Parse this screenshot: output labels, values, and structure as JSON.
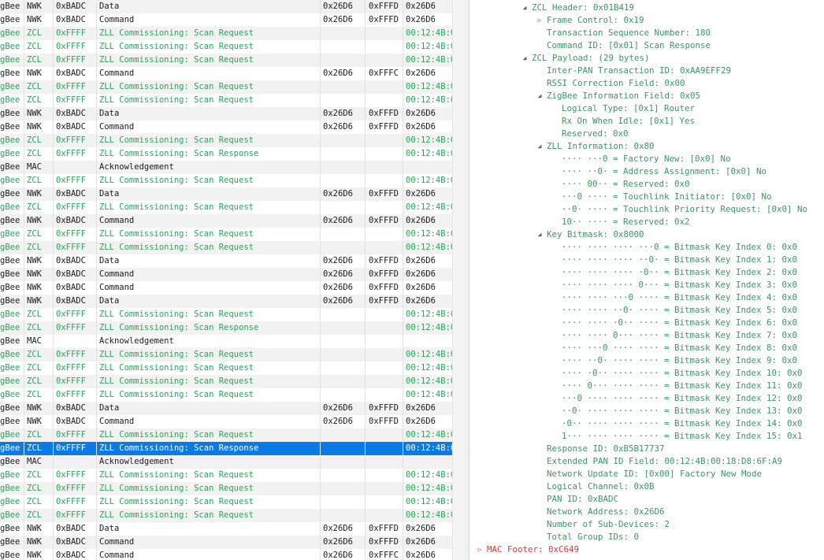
{
  "packet_list": {
    "rows": [
      {
        "proto": "gBee",
        "layer": "NWK",
        "dst": "0xBADC",
        "info": "Data",
        "a": "0x26D6",
        "b": "0xFFFD",
        "c": "0x26D6",
        "kind": "other"
      },
      {
        "proto": "gBee",
        "layer": "NWK",
        "dst": "0xBADC",
        "info": "Command",
        "a": "0x26D6",
        "b": "0xFFFD",
        "c": "0x26D6",
        "kind": "other"
      },
      {
        "proto": "gBee",
        "layer": "ZCL",
        "dst": "0xFFFF",
        "info": "ZLL Commissioning: Scan Request",
        "a": "",
        "b": "",
        "c": "00:12:4B:0",
        "kind": "zll"
      },
      {
        "proto": "gBee",
        "layer": "ZCL",
        "dst": "0xFFFF",
        "info": "ZLL Commissioning: Scan Request",
        "a": "",
        "b": "",
        "c": "00:12:4B:0",
        "kind": "zll"
      },
      {
        "proto": "gBee",
        "layer": "ZCL",
        "dst": "0xFFFF",
        "info": "ZLL Commissioning: Scan Request",
        "a": "",
        "b": "",
        "c": "00:12:4B:0",
        "kind": "zll"
      },
      {
        "proto": "gBee",
        "layer": "NWK",
        "dst": "0xBADC",
        "info": "Command",
        "a": "0x26D6",
        "b": "0xFFFC",
        "c": "0x26D6",
        "kind": "other"
      },
      {
        "proto": "gBee",
        "layer": "ZCL",
        "dst": "0xFFFF",
        "info": "ZLL Commissioning: Scan Request",
        "a": "",
        "b": "",
        "c": "00:12:4B:0",
        "kind": "zll"
      },
      {
        "proto": "gBee",
        "layer": "ZCL",
        "dst": "0xFFFF",
        "info": "ZLL Commissioning: Scan Request",
        "a": "",
        "b": "",
        "c": "00:12:4B:0",
        "kind": "zll"
      },
      {
        "proto": "gBee",
        "layer": "NWK",
        "dst": "0xBADC",
        "info": "Data",
        "a": "0x26D6",
        "b": "0xFFFD",
        "c": "0x26D6",
        "kind": "other"
      },
      {
        "proto": "gBee",
        "layer": "NWK",
        "dst": "0xBADC",
        "info": "Command",
        "a": "0x26D6",
        "b": "0xFFFD",
        "c": "0x26D6",
        "kind": "other"
      },
      {
        "proto": "gBee",
        "layer": "ZCL",
        "dst": "0xFFFF",
        "info": "ZLL Commissioning: Scan Request",
        "a": "",
        "b": "",
        "c": "00:12:4B:0",
        "kind": "zll"
      },
      {
        "proto": "gBee",
        "layer": "ZCL",
        "dst": "0xFFFF",
        "info": "ZLL Commissioning: Scan Response",
        "a": "",
        "b": "",
        "c": "00:12:4B:0",
        "kind": "zll"
      },
      {
        "proto": "gBee",
        "layer": "MAC",
        "dst": "",
        "info": "Acknowledgement",
        "a": "",
        "b": "",
        "c": "",
        "kind": "other"
      },
      {
        "proto": "gBee",
        "layer": "ZCL",
        "dst": "0xFFFF",
        "info": "ZLL Commissioning: Scan Request",
        "a": "",
        "b": "",
        "c": "00:12:4B:0",
        "kind": "zll"
      },
      {
        "proto": "gBee",
        "layer": "NWK",
        "dst": "0xBADC",
        "info": "Data",
        "a": "0x26D6",
        "b": "0xFFFD",
        "c": "0x26D6",
        "kind": "other"
      },
      {
        "proto": "gBee",
        "layer": "ZCL",
        "dst": "0xFFFF",
        "info": "ZLL Commissioning: Scan Request",
        "a": "",
        "b": "",
        "c": "00:12:4B:0",
        "kind": "zll"
      },
      {
        "proto": "gBee",
        "layer": "NWK",
        "dst": "0xBADC",
        "info": "Command",
        "a": "0x26D6",
        "b": "0xFFFD",
        "c": "0x26D6",
        "kind": "other"
      },
      {
        "proto": "gBee",
        "layer": "ZCL",
        "dst": "0xFFFF",
        "info": "ZLL Commissioning: Scan Request",
        "a": "",
        "b": "",
        "c": "00:12:4B:0",
        "kind": "zll"
      },
      {
        "proto": "gBee",
        "layer": "ZCL",
        "dst": "0xFFFF",
        "info": "ZLL Commissioning: Scan Request",
        "a": "",
        "b": "",
        "c": "00:12:4B:0",
        "kind": "zll"
      },
      {
        "proto": "gBee",
        "layer": "NWK",
        "dst": "0xBADC",
        "info": "Data",
        "a": "0x26D6",
        "b": "0xFFFD",
        "c": "0x26D6",
        "kind": "other"
      },
      {
        "proto": "gBee",
        "layer": "NWK",
        "dst": "0xBADC",
        "info": "Command",
        "a": "0x26D6",
        "b": "0xFFFD",
        "c": "0x26D6",
        "kind": "other"
      },
      {
        "proto": "gBee",
        "layer": "NWK",
        "dst": "0xBADC",
        "info": "Command",
        "a": "0x26D6",
        "b": "0xFFFD",
        "c": "0x26D6",
        "kind": "other"
      },
      {
        "proto": "gBee",
        "layer": "NWK",
        "dst": "0xBADC",
        "info": "Data",
        "a": "0x26D6",
        "b": "0xFFFD",
        "c": "0x26D6",
        "kind": "other"
      },
      {
        "proto": "gBee",
        "layer": "ZCL",
        "dst": "0xFFFF",
        "info": "ZLL Commissioning: Scan Request",
        "a": "",
        "b": "",
        "c": "00:12:4B:0",
        "kind": "zll"
      },
      {
        "proto": "gBee",
        "layer": "ZCL",
        "dst": "0xFFFF",
        "info": "ZLL Commissioning: Scan Response",
        "a": "",
        "b": "",
        "c": "00:12:4B:0",
        "kind": "zll"
      },
      {
        "proto": "gBee",
        "layer": "MAC",
        "dst": "",
        "info": "Acknowledgement",
        "a": "",
        "b": "",
        "c": "",
        "kind": "other"
      },
      {
        "proto": "gBee",
        "layer": "ZCL",
        "dst": "0xFFFF",
        "info": "ZLL Commissioning: Scan Request",
        "a": "",
        "b": "",
        "c": "00:12:4B:0",
        "kind": "zll"
      },
      {
        "proto": "gBee",
        "layer": "ZCL",
        "dst": "0xFFFF",
        "info": "ZLL Commissioning: Scan Request",
        "a": "",
        "b": "",
        "c": "00:12:4B:0",
        "kind": "zll"
      },
      {
        "proto": "gBee",
        "layer": "ZCL",
        "dst": "0xFFFF",
        "info": "ZLL Commissioning: Scan Request",
        "a": "",
        "b": "",
        "c": "00:12:4B:0",
        "kind": "zll"
      },
      {
        "proto": "gBee",
        "layer": "ZCL",
        "dst": "0xFFFF",
        "info": "ZLL Commissioning: Scan Request",
        "a": "",
        "b": "",
        "c": "00:12:4B:0",
        "kind": "zll"
      },
      {
        "proto": "gBee",
        "layer": "NWK",
        "dst": "0xBADC",
        "info": "Data",
        "a": "0x26D6",
        "b": "0xFFFD",
        "c": "0x26D6",
        "kind": "other"
      },
      {
        "proto": "gBee",
        "layer": "NWK",
        "dst": "0xBADC",
        "info": "Command",
        "a": "0x26D6",
        "b": "0xFFFD",
        "c": "0x26D6",
        "kind": "other"
      },
      {
        "proto": "gBee",
        "layer": "ZCL",
        "dst": "0xFFFF",
        "info": "ZLL Commissioning: Scan Request",
        "a": "",
        "b": "",
        "c": "00:12:4B:0",
        "kind": "zll"
      },
      {
        "proto": "gBee",
        "layer": "ZCL",
        "dst": "0xFFFF",
        "info": "ZLL Commissioning: Scan Response",
        "a": "",
        "b": "",
        "c": "00:12:4B:0",
        "kind": "zll",
        "selected": true
      },
      {
        "proto": "gBee",
        "layer": "MAC",
        "dst": "",
        "info": "Acknowledgement",
        "a": "",
        "b": "",
        "c": "",
        "kind": "other"
      },
      {
        "proto": "gBee",
        "layer": "ZCL",
        "dst": "0xFFFF",
        "info": "ZLL Commissioning: Scan Request",
        "a": "",
        "b": "",
        "c": "00:12:4B:0",
        "kind": "zll"
      },
      {
        "proto": "gBee",
        "layer": "ZCL",
        "dst": "0xFFFF",
        "info": "ZLL Commissioning: Scan Request",
        "a": "",
        "b": "",
        "c": "00:12:4B:0",
        "kind": "zll"
      },
      {
        "proto": "gBee",
        "layer": "ZCL",
        "dst": "0xFFFF",
        "info": "ZLL Commissioning: Scan Request",
        "a": "",
        "b": "",
        "c": "00:12:4B:0",
        "kind": "zll"
      },
      {
        "proto": "gBee",
        "layer": "ZCL",
        "dst": "0xFFFF",
        "info": "ZLL Commissioning: Scan Request",
        "a": "",
        "b": "",
        "c": "00:12:4B:0",
        "kind": "zll"
      },
      {
        "proto": "gBee",
        "layer": "NWK",
        "dst": "0xBADC",
        "info": "Data",
        "a": "0x26D6",
        "b": "0xFFFD",
        "c": "0x26D6",
        "kind": "other"
      },
      {
        "proto": "gBee",
        "layer": "NWK",
        "dst": "0xBADC",
        "info": "Command",
        "a": "0x26D6",
        "b": "0xFFFD",
        "c": "0x26D6",
        "kind": "other"
      },
      {
        "proto": "gBee",
        "layer": "NWK",
        "dst": "0xBADC",
        "info": "Command",
        "a": "0x26D6",
        "b": "0xFFFC",
        "c": "0x26D6",
        "kind": "other"
      }
    ]
  },
  "detail": {
    "rows": [
      {
        "depth": 3,
        "toggle": "expanded",
        "text": "ZCL Header: 0x01B419"
      },
      {
        "depth": 4,
        "toggle": "collapsed",
        "text": "Frame Control: 0x19"
      },
      {
        "depth": 4,
        "toggle": "none",
        "text": "Transaction Sequence Number: 180"
      },
      {
        "depth": 4,
        "toggle": "none",
        "text": "Command ID: [0x01] Scan Response"
      },
      {
        "depth": 3,
        "toggle": "expanded",
        "text": "ZCL Payload: (29 bytes)"
      },
      {
        "depth": 4,
        "toggle": "none",
        "text": "Inter-PAN Transaction ID: 0xAA9EFF29"
      },
      {
        "depth": 4,
        "toggle": "none",
        "text": "RSSI Correction Field: 0x00"
      },
      {
        "depth": 4,
        "toggle": "expanded",
        "text": "ZigBee Information Field: 0x05"
      },
      {
        "depth": 5,
        "toggle": "none",
        "text": "Logical Type: [0x1] Router"
      },
      {
        "depth": 5,
        "toggle": "none",
        "text": "Rx On When Idle: [0x1] Yes"
      },
      {
        "depth": 5,
        "toggle": "none",
        "text": "Reserved: 0x0"
      },
      {
        "depth": 4,
        "toggle": "expanded",
        "text": "ZLL Information: 0x80"
      },
      {
        "depth": 5,
        "toggle": "none",
        "text": "···· ···0 = Factory New: [0x0] No"
      },
      {
        "depth": 5,
        "toggle": "none",
        "text": "···· ··0· = Address Assignment: [0x0] No"
      },
      {
        "depth": 5,
        "toggle": "none",
        "text": "···· 00·· = Reserved: 0x0"
      },
      {
        "depth": 5,
        "toggle": "none",
        "text": "···0 ···· = Touchlink Initiator: [0x0] No"
      },
      {
        "depth": 5,
        "toggle": "none",
        "text": "··0· ···· = Touchlink Priority Request: [0x0] No"
      },
      {
        "depth": 5,
        "toggle": "none",
        "text": "10·· ···· = Reserved: 0x2"
      },
      {
        "depth": 4,
        "toggle": "expanded",
        "text": "Key Bitmask: 0x8000"
      },
      {
        "depth": 5,
        "toggle": "none",
        "text": "···· ···· ···· ···0 = Bitmask Key Index 0: 0x0"
      },
      {
        "depth": 5,
        "toggle": "none",
        "text": "···· ···· ···· ··0· = Bitmask Key Index 1: 0x0"
      },
      {
        "depth": 5,
        "toggle": "none",
        "text": "···· ···· ···· ·0·· = Bitmask Key Index 2: 0x0"
      },
      {
        "depth": 5,
        "toggle": "none",
        "text": "···· ···· ···· 0··· = Bitmask Key Index 3: 0x0"
      },
      {
        "depth": 5,
        "toggle": "none",
        "text": "···· ···· ···0 ···· = Bitmask Key Index 4: 0x0"
      },
      {
        "depth": 5,
        "toggle": "none",
        "text": "···· ···· ··0· ···· = Bitmask Key Index 5: 0x0"
      },
      {
        "depth": 5,
        "toggle": "none",
        "text": "···· ···· ·0·· ···· = Bitmask Key Index 6: 0x0"
      },
      {
        "depth": 5,
        "toggle": "none",
        "text": "···· ···· 0··· ···· = Bitmask Key Index 7: 0x0"
      },
      {
        "depth": 5,
        "toggle": "none",
        "text": "···· ···0 ···· ···· = Bitmask Key Index 8: 0x0"
      },
      {
        "depth": 5,
        "toggle": "none",
        "text": "···· ··0· ···· ···· = Bitmask Key Index 9: 0x0"
      },
      {
        "depth": 5,
        "toggle": "none",
        "text": "···· ·0·· ···· ···· = Bitmask Key Index 10: 0x0"
      },
      {
        "depth": 5,
        "toggle": "none",
        "text": "···· 0··· ···· ···· = Bitmask Key Index 11: 0x0"
      },
      {
        "depth": 5,
        "toggle": "none",
        "text": "···0 ···· ···· ···· = Bitmask Key Index 12: 0x0"
      },
      {
        "depth": 5,
        "toggle": "none",
        "text": "··0· ···· ···· ···· = Bitmask Key Index 13: 0x0"
      },
      {
        "depth": 5,
        "toggle": "none",
        "text": "·0·· ···· ···· ···· = Bitmask Key Index 14: 0x0"
      },
      {
        "depth": 5,
        "toggle": "none",
        "text": "1··· ···· ···· ···· = Bitmask Key Index 15: 0x1"
      },
      {
        "depth": 4,
        "toggle": "none",
        "text": "Response ID: 0xB5B17737"
      },
      {
        "depth": 4,
        "toggle": "none",
        "text": "Extended PAN ID Field: 00:12:4B:00:18:D8:6F:A9"
      },
      {
        "depth": 4,
        "toggle": "none",
        "text": "Network Update ID: [0x00] Factory New Mode"
      },
      {
        "depth": 4,
        "toggle": "none",
        "text": "Logical Channel: 0x0B"
      },
      {
        "depth": 4,
        "toggle": "none",
        "text": "PAN ID: 0xBADC"
      },
      {
        "depth": 4,
        "toggle": "none",
        "text": "Network Address: 0x26D6"
      },
      {
        "depth": 4,
        "toggle": "none",
        "text": "Number of Sub-Devices: 2"
      },
      {
        "depth": 4,
        "toggle": "none",
        "text": "Total Group IDs: 0"
      },
      {
        "depth": 0,
        "toggle": "collapsed",
        "text": "MAC Footer: 0xC649",
        "color": "red"
      }
    ]
  },
  "colors": {
    "zll_green": "#26a658",
    "detail_green": "#3b9560",
    "selection_blue": "#0a7ae6",
    "footer_red": "#cc3b3b",
    "stripe_gray": "#f2f2f2"
  },
  "icons": {
    "expanded": "triangle-down-icon",
    "collapsed": "triangle-right-icon"
  }
}
